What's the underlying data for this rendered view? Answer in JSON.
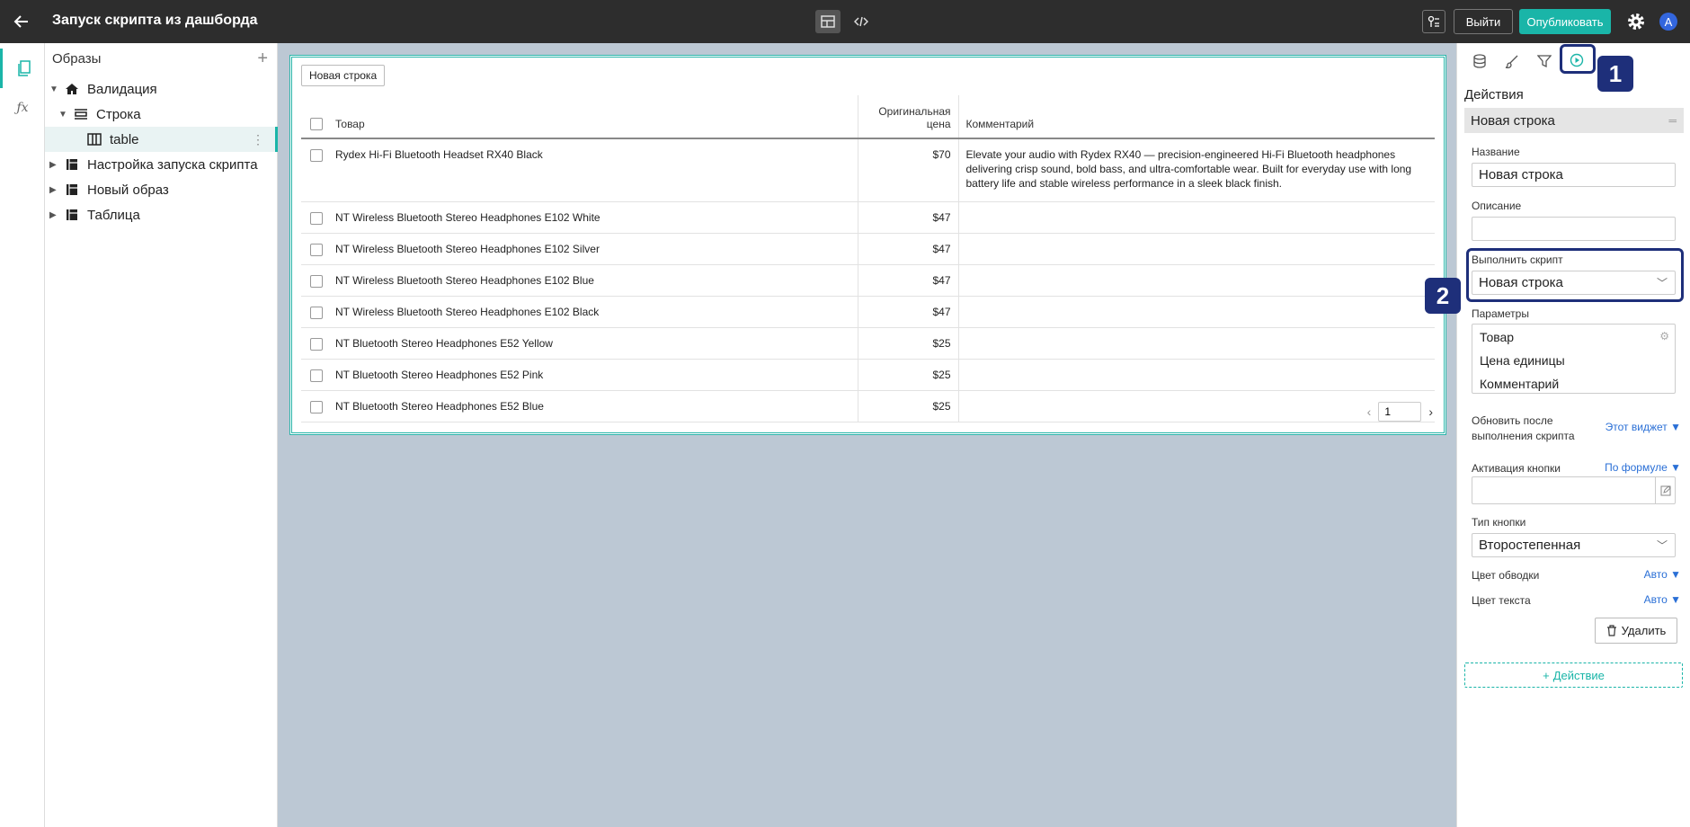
{
  "header": {
    "title": "Запуск скрипта из дашборда",
    "exit_label": "Выйти",
    "publish_label": "Опубликовать",
    "avatar_letter": "A"
  },
  "rail": {
    "formula_label": "ƒx"
  },
  "tree": {
    "title": "Образы",
    "nodes": [
      {
        "label": "Валидация",
        "icon": "home-icon"
      },
      {
        "label": "Строка",
        "icon": "row-icon"
      },
      {
        "label": "table",
        "icon": "table-icon"
      },
      {
        "label": "Настройка запуска скрипта",
        "icon": "page-icon"
      },
      {
        "label": "Новый образ",
        "icon": "page-icon"
      },
      {
        "label": "Таблица",
        "icon": "page-icon"
      }
    ]
  },
  "widget": {
    "new_row_label": "Новая строка",
    "columns": {
      "product": "Товар",
      "price_line1": "Оригинальная",
      "price_line2": "цена",
      "comment": "Комментарий"
    },
    "rows": [
      {
        "product": "Rydex Hi-Fi Bluetooth Headset RX40 Black",
        "price": "$70",
        "comment": "Elevate your audio with Rydex RX40 — precision-engineered Hi-Fi Bluetooth headphones delivering crisp sound, bold bass, and ultra-comfortable wear. Built for everyday use with long battery life and stable wireless performance in a sleek black finish."
      },
      {
        "product": "NT Wireless Bluetooth Stereo Headphones E102 White",
        "price": "$47",
        "comment": ""
      },
      {
        "product": "NT Wireless Bluetooth Stereo Headphones E102 Silver",
        "price": "$47",
        "comment": ""
      },
      {
        "product": "NT Wireless Bluetooth Stereo Headphones E102 Blue",
        "price": "$47",
        "comment": ""
      },
      {
        "product": "NT Wireless Bluetooth Stereo Headphones E102 Black",
        "price": "$47",
        "comment": ""
      },
      {
        "product": "NT Bluetooth Stereo Headphones E52 Yellow",
        "price": "$25",
        "comment": ""
      },
      {
        "product": "NT Bluetooth Stereo Headphones E52 Pink",
        "price": "$25",
        "comment": ""
      },
      {
        "product": "NT Bluetooth Stereo Headphones E52 Blue",
        "price": "$25",
        "comment": ""
      }
    ],
    "page": "1"
  },
  "props": {
    "section_title": "Действия",
    "action_name": "Новая строка",
    "name_label": "Название",
    "name_value": "Новая строка",
    "description_label": "Описание",
    "description_value": "",
    "script_label": "Выполнить скрипт",
    "script_value": "Новая строка",
    "params_label": "Параметры",
    "params": [
      "Товар",
      "Цена единицы",
      "Комментарий"
    ],
    "refresh_label_line1": "Обновить после",
    "refresh_label_line2": "выполнения скрипта",
    "refresh_value": "Этот виджет",
    "activation_label": "Активация кнопки",
    "activation_value": "По формуле",
    "button_type_label": "Тип кнопки",
    "button_type_value": "Второстепенная",
    "border_color_label": "Цвет обводки",
    "border_color_value": "Авто",
    "text_color_label": "Цвет текста",
    "text_color_value": "Авто",
    "delete_label": "Удалить",
    "add_action_label": "Действие"
  },
  "annotations": {
    "badge1": "1",
    "badge2": "2"
  },
  "colors": {
    "accent": "#1ab5a8",
    "topbar": "#2d2d2d",
    "canvas": "#bcc8d4",
    "annotation": "#1e2f7a",
    "link": "#2a6fd6"
  }
}
